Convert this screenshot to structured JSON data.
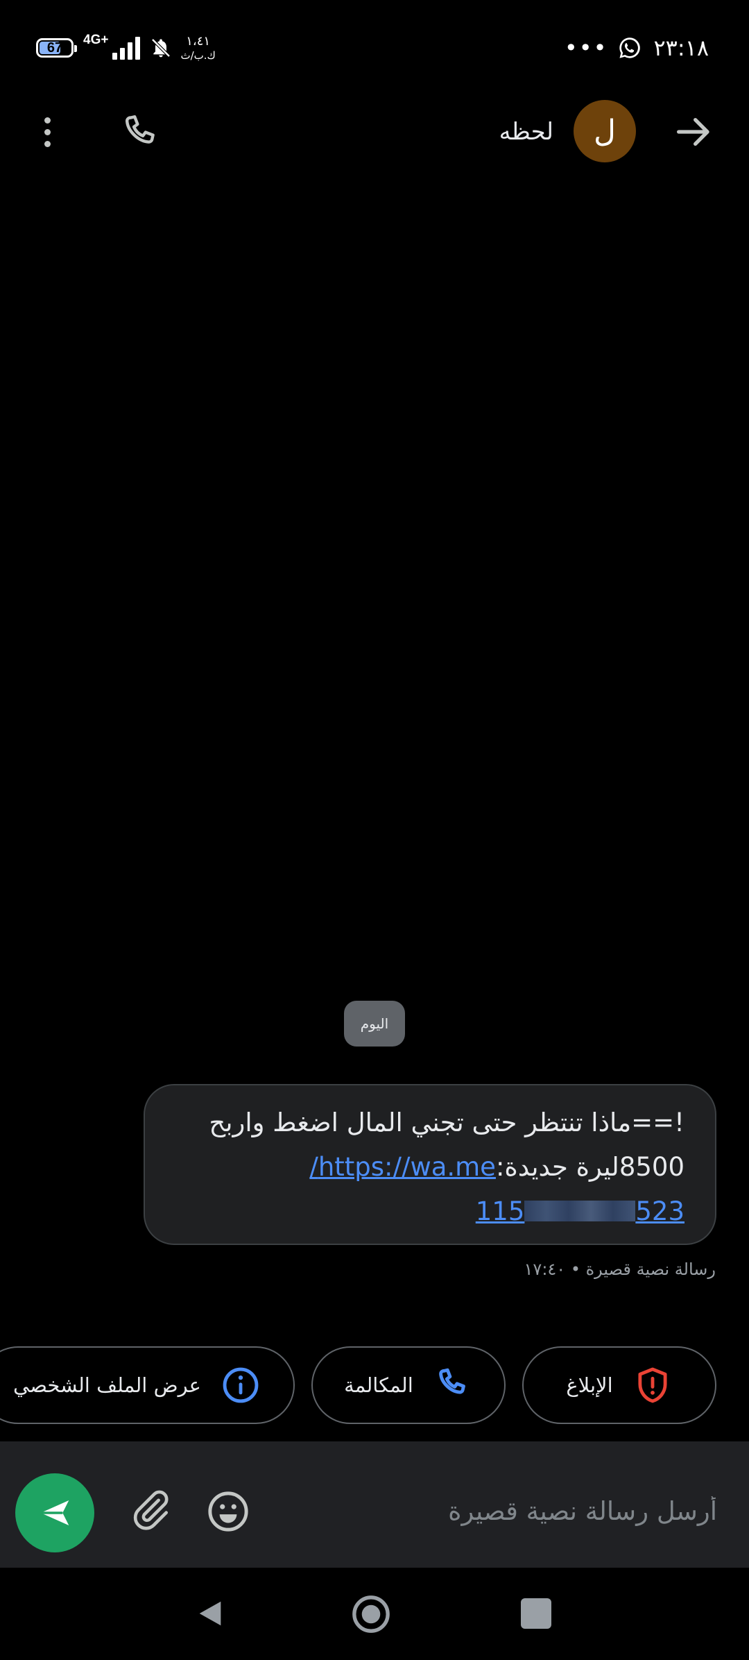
{
  "status_bar": {
    "battery": "67",
    "network": "4G+",
    "signal_bars": 4,
    "speed_value": "١،٤١",
    "speed_unit": "ك.ب/ث",
    "time": "٢٣:١٨",
    "more_indicator": "•••"
  },
  "app_bar": {
    "contact_name": "لحظه",
    "avatar_letter": "ل",
    "avatar_color": "#6e420b"
  },
  "conversation": {
    "date_label": "اليوم",
    "message": {
      "line1": "!==ماذا تنتظر حتى تجني المال اضغط واربح",
      "line2_text": "8500ليرة جديدة:",
      "line2_link": "https://wa.me/",
      "line3_link_start": "115",
      "line3_link_end": "523"
    },
    "meta": "رسالة نصية قصيرة • ١٧:٤٠"
  },
  "suggestions": {
    "report_label": "الإبلاغ",
    "call_label": "المكالمة",
    "profile_label": "عرض الملف الشخصي"
  },
  "compose": {
    "placeholder": "أرسل رسالة نصية قصيرة"
  },
  "colors": {
    "accent_link": "#4c8df6",
    "send_green": "#1ea362",
    "report_red": "#ea4335",
    "blue_icon": "#4c8df6"
  }
}
